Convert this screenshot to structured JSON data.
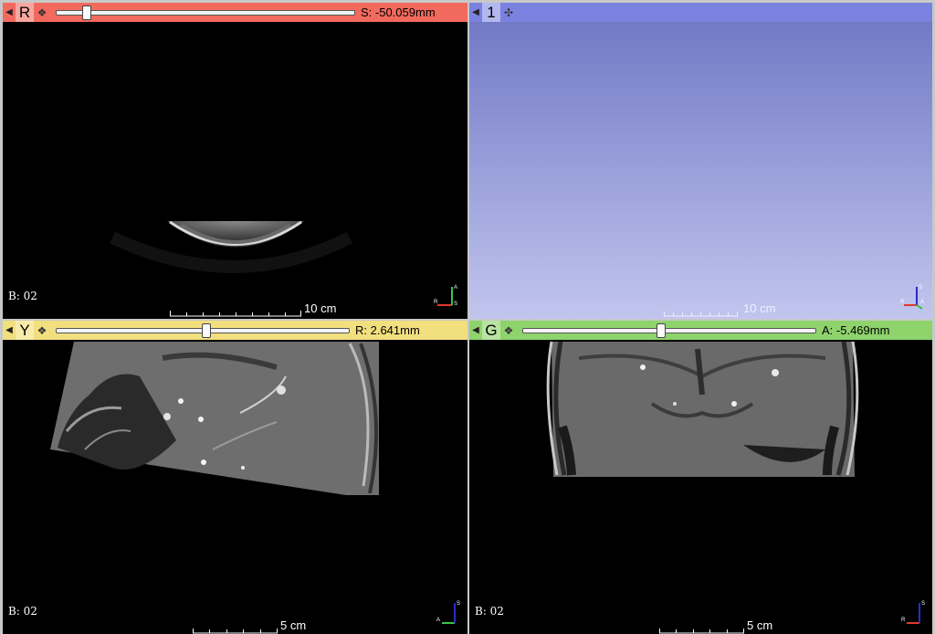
{
  "views": {
    "red": {
      "letter": "R",
      "offset": "S: -50.059mm",
      "slider_fraction": 0.1,
      "layer_label": "B: 02",
      "ruler_label": "10 cm",
      "color": "#f26a5e",
      "letter_bg": "#f7a79f"
    },
    "three_d": {
      "letter": "1",
      "ruler_label": "10 cm",
      "color": "#7a82e0",
      "letter_bg": "#b3b8ee",
      "gradient_top": "#727ac6",
      "gradient_bottom": "#c1c5ee"
    },
    "yellow": {
      "letter": "Y",
      "offset": "R: 2.641mm",
      "slider_fraction": 0.51,
      "layer_label": "B: 02",
      "ruler_label": "5 cm",
      "color": "#f2df7e",
      "letter_bg": "#f8eca9"
    },
    "green": {
      "letter": "G",
      "offset": "A: -5.469mm",
      "slider_fraction": 0.47,
      "layer_label": "B: 02",
      "ruler_label": "5 cm",
      "color": "#8ed36c",
      "letter_bg": "#b8e3a0"
    }
  }
}
